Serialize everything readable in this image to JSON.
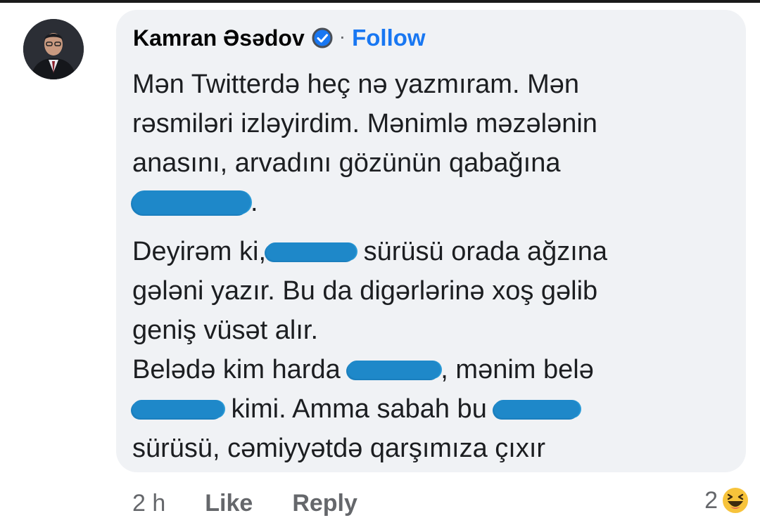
{
  "comment": {
    "author": "Kamran Əsədov",
    "follow_label": "Follow",
    "separator": "·",
    "lines": [
      "Mən Twitterdə heç nə yazmıram. Mən",
      "rəsmiləri izləyirdim. Mənimlə məzələnin",
      "anasını, arvadını gözünün qabağına"
    ],
    "line4_end": ".",
    "line5_before": "Deyirəm ki,",
    "line5_after": " sürüsü orada ağzına",
    "line6": "gələni yazır. Bu da digərlərinə xoş gəlib",
    "line7": "geniş vüsət alır.",
    "line8_before": "Belədə kim harda ",
    "line8_after": ", mənim belə",
    "line9_after": " kimi. Amma sabah bu ",
    "line10": "sürüsü, cəmiyyətdə qarşımıza çıxır"
  },
  "actions": {
    "time": "2 h",
    "like": "Like",
    "reply": "Reply"
  },
  "reactions": {
    "count": "2",
    "icon": "haha-emoji-icon"
  },
  "colors": {
    "bubble": "#f0f2f5",
    "link": "#1877f2",
    "meta": "#65676b",
    "redaction": "#1e88c9"
  }
}
